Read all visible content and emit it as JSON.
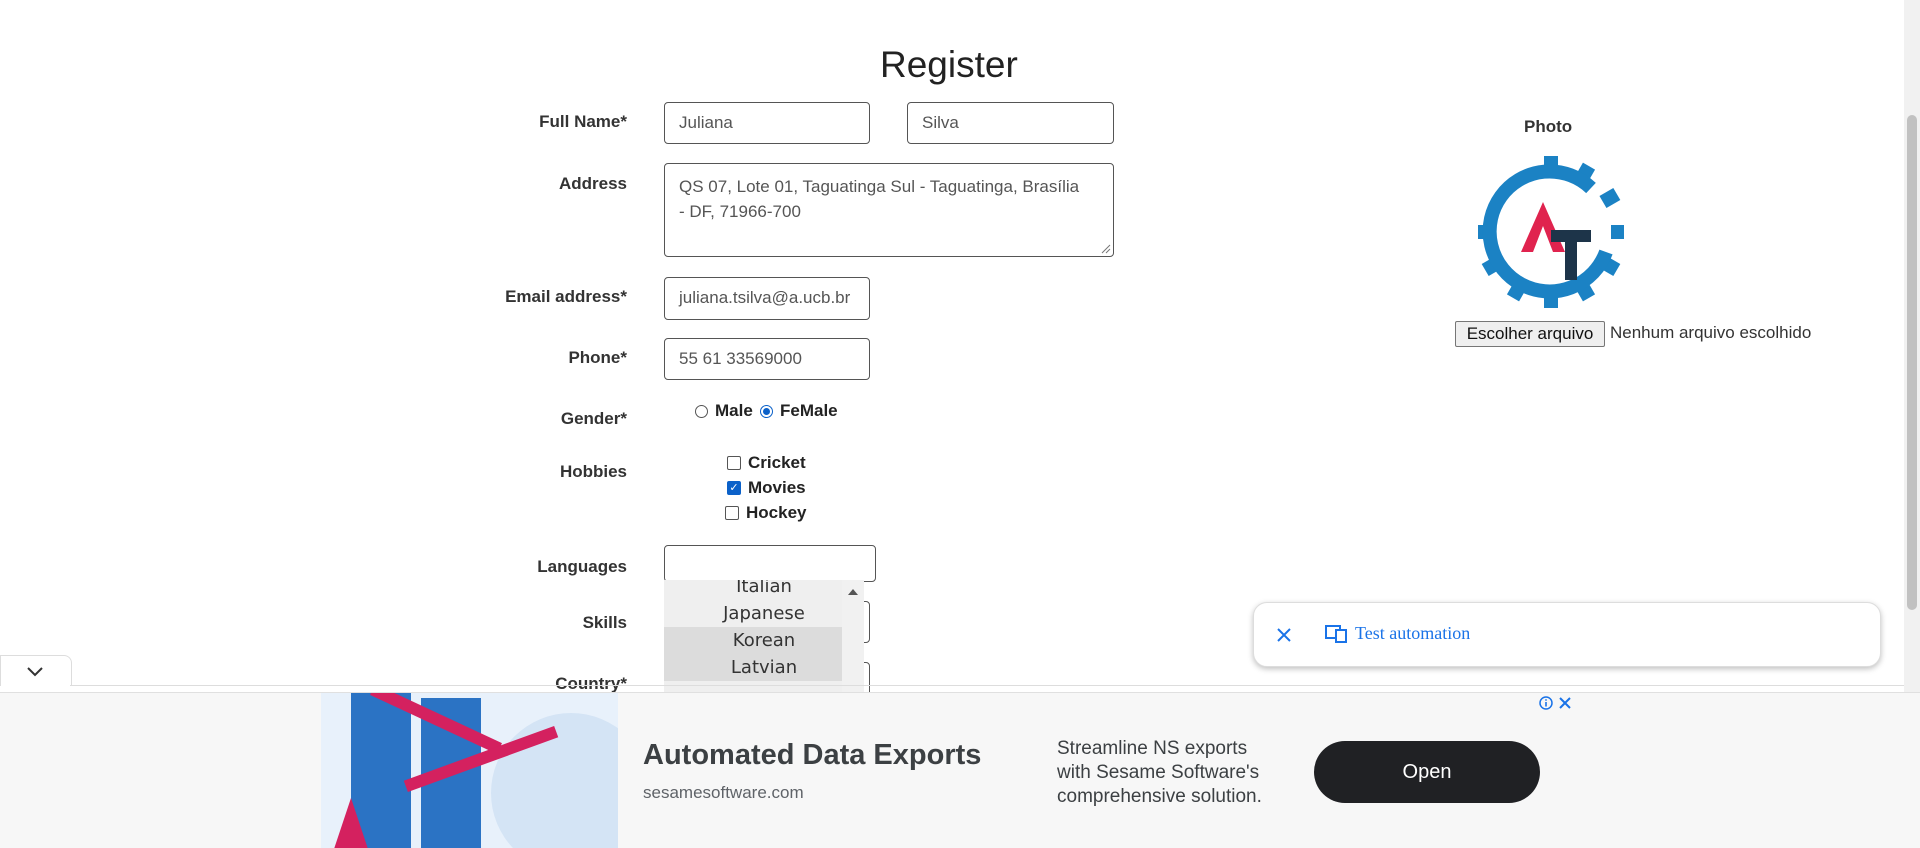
{
  "page": {
    "title": "Register"
  },
  "form": {
    "full_name_label": "Full Name*",
    "first_name": "Juliana",
    "last_name": "Silva",
    "address_label": "Address",
    "address_line1": "QS 07, Lote 01, Taguatinga Sul - Taguatinga, Brasília",
    "address_line2": "- DF, 71966-700",
    "email_label": "Email address*",
    "email": "juliana.tsilva@a.ucb.br",
    "phone_label": "Phone*",
    "phone": "55 61 33569000",
    "gender_label": "Gender*",
    "gender_male": "Male",
    "gender_female": "FeMale",
    "gender_selected": "FeMale",
    "hobbies_label": "Hobbies",
    "hobbies": [
      {
        "label": "Cricket",
        "checked": false
      },
      {
        "label": "Movies",
        "checked": true
      },
      {
        "label": "Hockey",
        "checked": false
      }
    ],
    "languages_label": "Languages",
    "languages_value": "",
    "languages_options": [
      "Italian",
      "Japanese",
      "Korean",
      "Latvian"
    ],
    "skills_label": "Skills",
    "country_label": "Country*"
  },
  "photo": {
    "label": "Photo",
    "choose_button": "Escolher arquivo",
    "no_file_text": "Nenhum arquivo escolhido",
    "logo_colors": {
      "gear": "#1b82c4",
      "a": "#e0234e",
      "t": "#1d3449"
    }
  },
  "toast": {
    "label": "Test automation"
  },
  "ad": {
    "headline": "Automated Data Exports",
    "domain": "sesamesoftware.com",
    "body_line1": "Streamline NS exports",
    "body_line2": "with Sesame Software's",
    "body_line3": "comprehensive solution.",
    "button": "Open"
  }
}
